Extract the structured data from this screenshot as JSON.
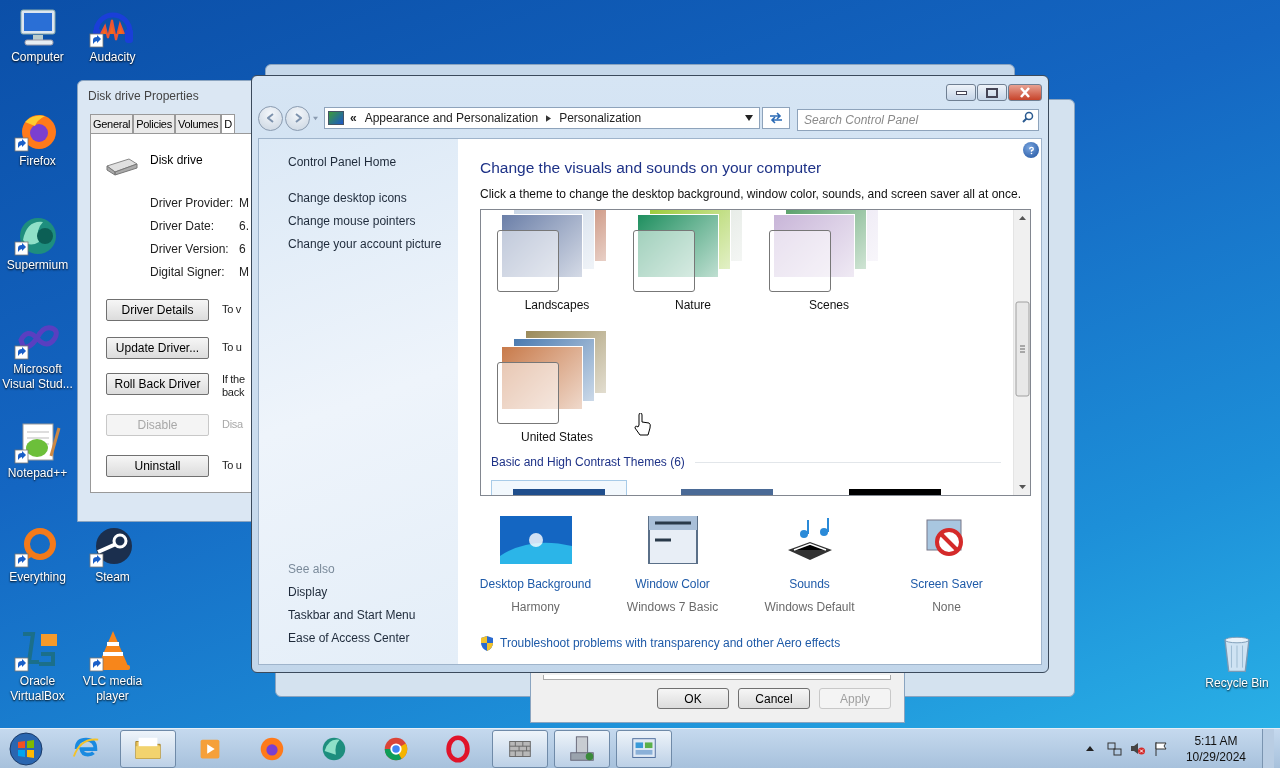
{
  "desktop_icon_rows": [
    [
      {
        "label": "Computer",
        "kind": "computer"
      },
      {
        "label": "Audacity",
        "kind": "audacity"
      }
    ],
    [
      {
        "label": "Firefox",
        "kind": "firefox"
      }
    ],
    [
      {
        "label": "Supermium",
        "kind": "supermium"
      }
    ],
    [
      {
        "label": "Microsoft Visual Stud...",
        "kind": "visual-studio"
      }
    ],
    [
      {
        "label": "Notepad++",
        "kind": "notepad"
      }
    ],
    [
      {
        "label": "Everything",
        "kind": "everything"
      },
      {
        "label": "Steam",
        "kind": "steam"
      }
    ],
    [
      {
        "label": "Oracle VirtualBox",
        "kind": "virtualbox"
      },
      {
        "label": "VLC media player",
        "kind": "vlc"
      }
    ]
  ],
  "recycle_bin": {
    "label": "Recycle Bin"
  },
  "background_dialog": {
    "buttons": [
      {
        "label": "OK",
        "disabled": false
      },
      {
        "label": "Cancel",
        "disabled": false
      },
      {
        "label": "Apply",
        "disabled": true
      }
    ]
  },
  "properties_window": {
    "title": "Disk drive Properties",
    "tabs": [
      {
        "label": "General",
        "selected": false
      },
      {
        "label": "Policies",
        "selected": false
      },
      {
        "label": "Volumes",
        "selected": false
      },
      {
        "label": "D",
        "selected": true
      }
    ],
    "device_name": "Disk drive",
    "fields": [
      {
        "label": "Driver Provider:",
        "value": "M"
      },
      {
        "label": "Driver Date:",
        "value": "6."
      },
      {
        "label": "Driver Version:",
        "value": "6"
      },
      {
        "label": "Digital Signer:",
        "value": "M"
      }
    ],
    "actions": [
      {
        "button": "Driver Details",
        "disabled": false,
        "description": [
          "To v"
        ]
      },
      {
        "button": "Update Driver...",
        "disabled": false,
        "description": [
          "To u"
        ]
      },
      {
        "button": "Roll Back Driver",
        "disabled": false,
        "description": [
          "If the",
          "back"
        ]
      },
      {
        "button": "Disable",
        "disabled": true,
        "description": [
          "Disa"
        ]
      },
      {
        "button": "Uninstall",
        "disabled": false,
        "description": [
          "To u"
        ]
      }
    ]
  },
  "control_panel": {
    "breadcrumb": {
      "overflow": "«",
      "items": [
        "Appearance and Personalization",
        "Personalization"
      ]
    },
    "search": {
      "placeholder": "Search Control Panel"
    },
    "sidebar": {
      "items": [
        "Control Panel Home",
        "Change desktop icons",
        "Change mouse pointers",
        "Change your account picture"
      ],
      "see_also_heading": "See also",
      "see_also": [
        "Display",
        "Taskbar and Start Menu",
        "Ease of Access Center"
      ]
    },
    "heading": "Change the visuals and sounds on your computer",
    "subheading": "Click a theme to change the desktop background, window color, sounds, and screen saver all at once.",
    "themes": [
      {
        "name": "Landscapes"
      },
      {
        "name": "Nature"
      },
      {
        "name": "Scenes"
      },
      {
        "name": "United States"
      }
    ],
    "basic_section": "Basic and High Contrast Themes (6)",
    "basic_themes": [
      {
        "selected": true,
        "color": "#1f4e8c"
      },
      {
        "selected": false,
        "color": "#4a6a96"
      },
      {
        "selected": false,
        "color": "#000000"
      }
    ],
    "settings": [
      {
        "kind": "background",
        "title": "Desktop Background",
        "value": "Harmony"
      },
      {
        "kind": "window-color",
        "title": "Window Color",
        "value": "Windows 7 Basic"
      },
      {
        "kind": "sounds",
        "title": "Sounds",
        "value": "Windows Default"
      },
      {
        "kind": "screen-saver",
        "title": "Screen Saver",
        "value": "None"
      }
    ],
    "troubleshoot_link": "Troubleshoot problems with transparency and other Aero effects"
  },
  "taskbar": {
    "items": [
      {
        "kind": "ie",
        "open": false
      },
      {
        "kind": "explorer",
        "open": true
      },
      {
        "kind": "media",
        "open": false
      },
      {
        "kind": "firefox",
        "open": false
      },
      {
        "kind": "supermium",
        "open": false
      },
      {
        "kind": "chrome",
        "open": false
      },
      {
        "kind": "opera",
        "open": false
      },
      {
        "kind": "firewall",
        "open": true
      },
      {
        "kind": "device",
        "open": true
      },
      {
        "kind": "control-panel",
        "open": true
      }
    ],
    "time": "5:11 AM",
    "date": "10/29/2024"
  }
}
